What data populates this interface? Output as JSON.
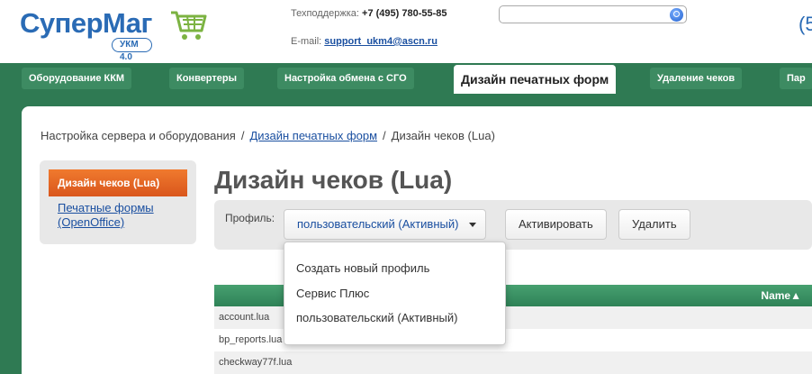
{
  "header": {
    "logo_text": "СуперМаг",
    "logo_badge": "УКМ 4.0",
    "support_label": "Техподдержка: ",
    "support_phone": "+7 (495) 780-55-85",
    "email_label": "E-mail: ",
    "email": "support_ukm4@ascn.ru",
    "right_fragment": "(5",
    "search_value": ""
  },
  "nav": {
    "tabs": [
      {
        "label": "Оборудование ККМ"
      },
      {
        "label": "Конвертеры"
      },
      {
        "label": "Настройка обмена с СГО"
      },
      {
        "label": "Дизайн печатных форм",
        "active": true
      },
      {
        "label": "Удаление чеков"
      },
      {
        "label": "Пар"
      }
    ]
  },
  "breadcrumb": {
    "root": "Настройка сервера и оборудования",
    "link": "Дизайн печатных форм",
    "current": "Дизайн чеков (Lua)",
    "separator": "/"
  },
  "sidebar": {
    "active": "Дизайн чеков (Lua)",
    "link": "Печатные формы (OpenOffice)"
  },
  "page_title": "Дизайн чеков (Lua)",
  "profile": {
    "label": "Профиль:",
    "selected": "пользовательский (Активный)",
    "activate": "Активировать",
    "delete": "Удалить",
    "options": [
      "Создать новый профиль",
      "Сервис Плюс",
      "пользовательский (Активный)"
    ]
  },
  "table": {
    "column_name": "Name",
    "rows": [
      "account.lua",
      "bp_reports.lua",
      "checkway77f.lua"
    ]
  },
  "colors": {
    "brand_blue": "#2a6bb5",
    "nav_green": "#2f7a53",
    "accent_orange": "#e8661f"
  }
}
